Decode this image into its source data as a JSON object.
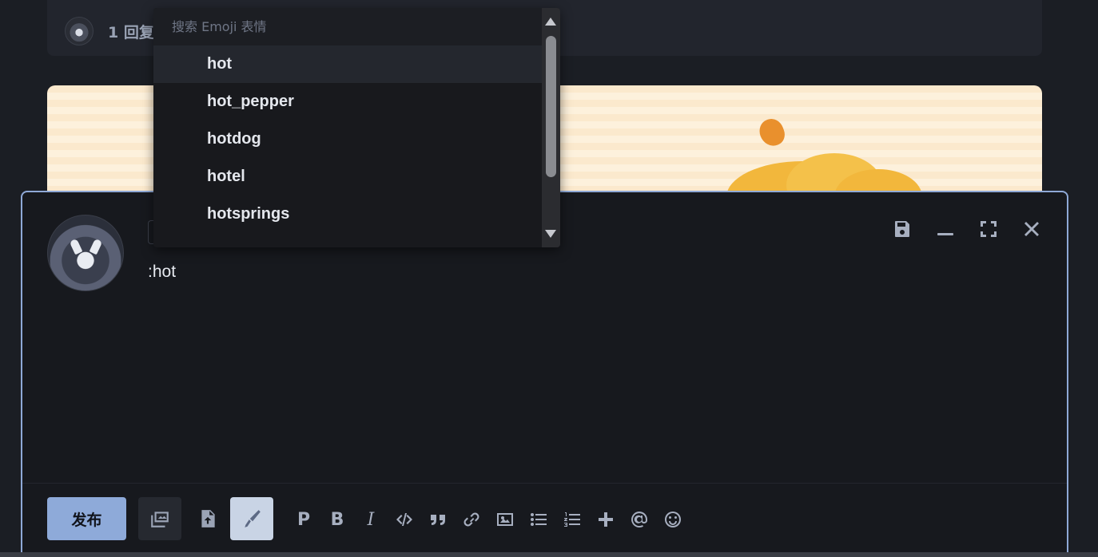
{
  "reply_card": {
    "count_label": "1 回复"
  },
  "emoji_picker": {
    "search_placeholder": "搜索 Emoji 表情",
    "items": [
      "hot",
      "hot_pepper",
      "hotdog",
      "hotel",
      "hotsprings"
    ],
    "active_index": 0
  },
  "composer": {
    "editor_text": ":hot",
    "publish_label": "发布",
    "controls": [
      "save-icon",
      "minimize-icon",
      "fullscreen-icon",
      "close-icon"
    ]
  },
  "toolbar": {
    "tools": [
      "images-icon",
      "upload-file-icon",
      "pen-icon"
    ],
    "format": {
      "paragraph": "P",
      "bold": "B",
      "italic": "I"
    },
    "format_icons": [
      "code-icon",
      "quote-icon",
      "link-icon",
      "image-icon",
      "bullet-list-icon",
      "numbered-list-icon",
      "plus-icon",
      "mention-icon",
      "emoji-icon"
    ]
  },
  "colors": {
    "accent": "#8eaad9",
    "background": "#17191e",
    "border": "#8fa9d6"
  }
}
